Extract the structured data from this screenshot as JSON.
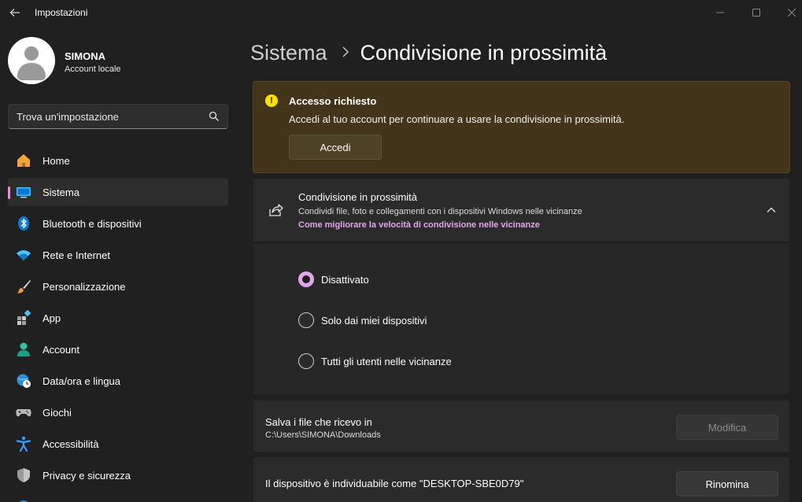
{
  "window": {
    "title": "Impostazioni",
    "controls": {
      "minimize_icon": "minimize-icon",
      "maximize_icon": "maximize-icon",
      "close_icon": "close-icon"
    }
  },
  "profile": {
    "name": "SIMONA",
    "account_type": "Account locale"
  },
  "search": {
    "placeholder": "Trova un'impostazione"
  },
  "sidebar": {
    "items": [
      {
        "label": "Home",
        "icon": "home-icon",
        "active": false
      },
      {
        "label": "Sistema",
        "icon": "system-icon",
        "active": true
      },
      {
        "label": "Bluetooth e dispositivi",
        "icon": "bluetooth-icon",
        "active": false
      },
      {
        "label": "Rete e Internet",
        "icon": "wifi-icon",
        "active": false
      },
      {
        "label": "Personalizzazione",
        "icon": "brush-icon",
        "active": false
      },
      {
        "label": "App",
        "icon": "apps-icon",
        "active": false
      },
      {
        "label": "Account",
        "icon": "account-icon",
        "active": false
      },
      {
        "label": "Data/ora e lingua",
        "icon": "globe-clock-icon",
        "active": false
      },
      {
        "label": "Giochi",
        "icon": "gamepad-icon",
        "active": false
      },
      {
        "label": "Accessibilità",
        "icon": "accessibility-icon",
        "active": false
      },
      {
        "label": "Privacy e sicurezza",
        "icon": "shield-icon",
        "active": false
      }
    ]
  },
  "breadcrumb": {
    "parent": "Sistema",
    "current": "Condivisione in prossimità"
  },
  "banner": {
    "title": "Accesso richiesto",
    "text": "Accedi al tuo account per continuare a usare la condivisione in prossimità.",
    "button": "Accedi",
    "icon": "warning-icon"
  },
  "nearby_share": {
    "title": "Condivisione in prossimità",
    "description": "Condividi file, foto e collegamenti con i dispositivi Windows nelle vicinanze",
    "link": "Come migliorare la velocità di condivisione nelle vicinanze",
    "options": [
      {
        "label": "Disattivato",
        "selected": true
      },
      {
        "label": "Solo dai miei dispositivi",
        "selected": false
      },
      {
        "label": "Tutti gli utenti nelle vicinanze",
        "selected": false
      }
    ]
  },
  "save_location": {
    "title": "Salva i file che ricevo in",
    "path": "C:\\Users\\SIMONA\\Downloads",
    "button": "Modifica"
  },
  "device_name": {
    "title": "Il dispositivo è individuabile come \"DESKTOP-SBE0D79\"",
    "button": "Rinomina"
  },
  "colors": {
    "accent": "#e3a4ee",
    "banner_bg": "#433519",
    "warning": "#fce100"
  }
}
